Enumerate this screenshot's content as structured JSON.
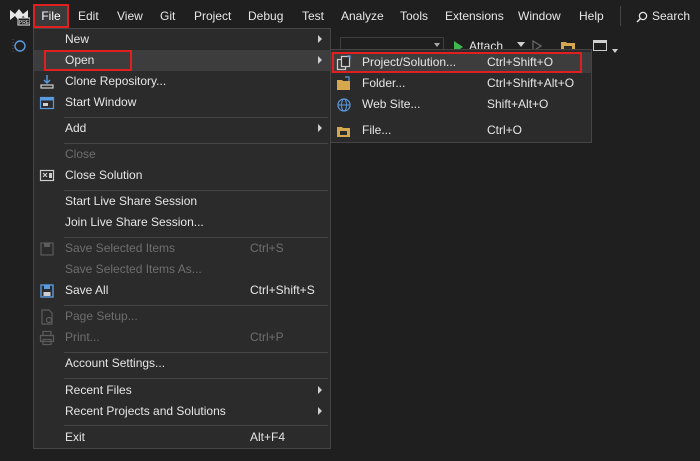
{
  "colors": {
    "background": "#1f1f1f",
    "menu_bg": "#2b2b2b",
    "highlight_box": "#e02020",
    "attach_play": "#3fb84f"
  },
  "menubar": {
    "logo_icon": "vs-preview-logo",
    "items": [
      "File",
      "Edit",
      "View",
      "Git",
      "Project",
      "Debug",
      "Test",
      "Analyze",
      "Tools",
      "Extensions",
      "Window",
      "Help"
    ],
    "search_label": "Search",
    "search_icon": "search-icon",
    "search_shortcut_chevron": "▾"
  },
  "toolbar": {
    "attach_label": "Attach"
  },
  "file_menu": {
    "items": [
      {
        "label": "New",
        "submenu": true
      },
      {
        "label": "Open",
        "submenu": true
      },
      {
        "label": "Clone Repository...",
        "icon": "clone-repo-icon"
      },
      {
        "label": "Start Window",
        "icon": "start-window-icon"
      },
      {
        "label": "Add",
        "submenu": true
      },
      {
        "label": "Close",
        "disabled": true
      },
      {
        "label": "Close Solution",
        "icon": "close-solution-icon"
      },
      {
        "label": "Start Live Share Session"
      },
      {
        "label": "Join Live Share Session..."
      },
      {
        "label": "Save Selected Items",
        "shortcut": "Ctrl+S",
        "disabled": true,
        "icon": "save-icon"
      },
      {
        "label": "Save Selected Items As...",
        "disabled": true
      },
      {
        "label": "Save All",
        "shortcut": "Ctrl+Shift+S",
        "icon": "save-all-icon"
      },
      {
        "label": "Page Setup...",
        "disabled": true,
        "icon": "page-setup-icon"
      },
      {
        "label": "Print...",
        "shortcut": "Ctrl+P",
        "disabled": true,
        "icon": "print-icon"
      },
      {
        "label": "Account Settings..."
      },
      {
        "label": "Recent Files",
        "submenu": true
      },
      {
        "label": "Recent Projects and Solutions",
        "submenu": true
      },
      {
        "label": "Exit",
        "shortcut": "Alt+F4"
      }
    ]
  },
  "open_submenu": {
    "items": [
      {
        "label": "Project/Solution...",
        "shortcut": "Ctrl+Shift+O",
        "icon": "project-solution-icon"
      },
      {
        "label": "Folder...",
        "shortcut": "Ctrl+Shift+Alt+O",
        "icon": "folder-icon"
      },
      {
        "label": "Web Site...",
        "shortcut": "Shift+Alt+O",
        "icon": "globe-icon"
      },
      {
        "label": "File...",
        "shortcut": "Ctrl+O",
        "icon": "open-file-icon"
      }
    ]
  }
}
